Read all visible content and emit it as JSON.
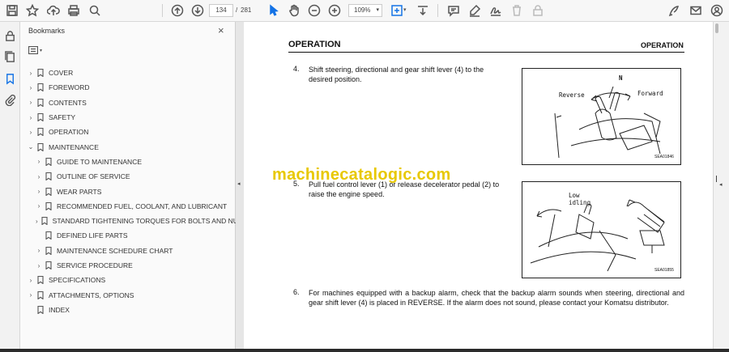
{
  "toolbar": {
    "page_current": "134",
    "page_separator": "/",
    "page_total": "281",
    "zoom": "109%"
  },
  "panel": {
    "title": "Bookmarks",
    "close": "×"
  },
  "bookmarks": [
    {
      "label": "COVER",
      "level": 0,
      "arrow": "›"
    },
    {
      "label": "FOREWORD",
      "level": 0,
      "arrow": "›"
    },
    {
      "label": "CONTENTS",
      "level": 0,
      "arrow": "›"
    },
    {
      "label": "SAFETY",
      "level": 0,
      "arrow": "›"
    },
    {
      "label": "OPERATION",
      "level": 0,
      "arrow": "›"
    },
    {
      "label": "MAINTENANCE",
      "level": 0,
      "arrow": "⌄"
    },
    {
      "label": "GUIDE TO MAINTENANCE",
      "level": 1,
      "arrow": "›"
    },
    {
      "label": "OUTLINE OF SERVICE",
      "level": 1,
      "arrow": "›"
    },
    {
      "label": "WEAR PARTS",
      "level": 1,
      "arrow": "›"
    },
    {
      "label": "RECOMMENDED FUEL, COOLANT, AND LUBRICANT",
      "level": 1,
      "arrow": "›"
    },
    {
      "label": "STANDARD TIGHTENING TORQUES FOR BOLTS AND NUTS",
      "level": 1,
      "arrow": "›"
    },
    {
      "label": "DEFINED LIFE PARTS",
      "level": 1,
      "arrow": ""
    },
    {
      "label": "MAINTENANCE SCHEDURE CHART",
      "level": 1,
      "arrow": "›"
    },
    {
      "label": "SERVICE PROCEDURE",
      "level": 1,
      "arrow": "›"
    },
    {
      "label": "SPECIFICATIONS",
      "level": 0,
      "arrow": "›"
    },
    {
      "label": "ATTACHMENTS, OPTIONS",
      "level": 0,
      "arrow": "›"
    },
    {
      "label": "INDEX",
      "level": 0,
      "arrow": ""
    }
  ],
  "document": {
    "header_left": "OPERATION",
    "header_right": "OPERATION",
    "steps": [
      {
        "num": "4.",
        "text": "Shift steering, directional and gear shift lever (4) to the desired position."
      },
      {
        "num": "5.",
        "text": "Pull fuel control lever (1) or release decelerator pedal (2) to raise the engine speed."
      },
      {
        "num": "6.",
        "text": "For machines equipped with a backup alarm, check that the backup alarm sounds when steering, directional and gear shift lever (4) is placed in REVERSE. If the alarm does not sound, please contact your Komatsu distributor."
      }
    ],
    "figure1": {
      "label_n": "N",
      "label_reverse": "Reverse",
      "label_forward": "Forward",
      "code": "SEA01846"
    },
    "figure2": {
      "label_low": "Low",
      "label_idling": "idling",
      "code": "SEA01855"
    },
    "watermark": "machinecatalogic.com"
  },
  "icons": [
    "save-icon",
    "star-icon",
    "upload-icon",
    "print-icon",
    "zoom-search-icon",
    "page-up-icon",
    "page-down-icon",
    "cursor-icon",
    "hand-icon",
    "zoom-out-icon",
    "zoom-in-icon",
    "fit-page-icon",
    "scroll-mode-icon",
    "comment-icon",
    "highlight-icon",
    "sign-icon",
    "delete-icon",
    "lock-icon",
    "edit-pdf-icon",
    "email-icon",
    "account-icon"
  ],
  "colors": {
    "accent": "#1473e6",
    "watermark": "#e8c800"
  }
}
